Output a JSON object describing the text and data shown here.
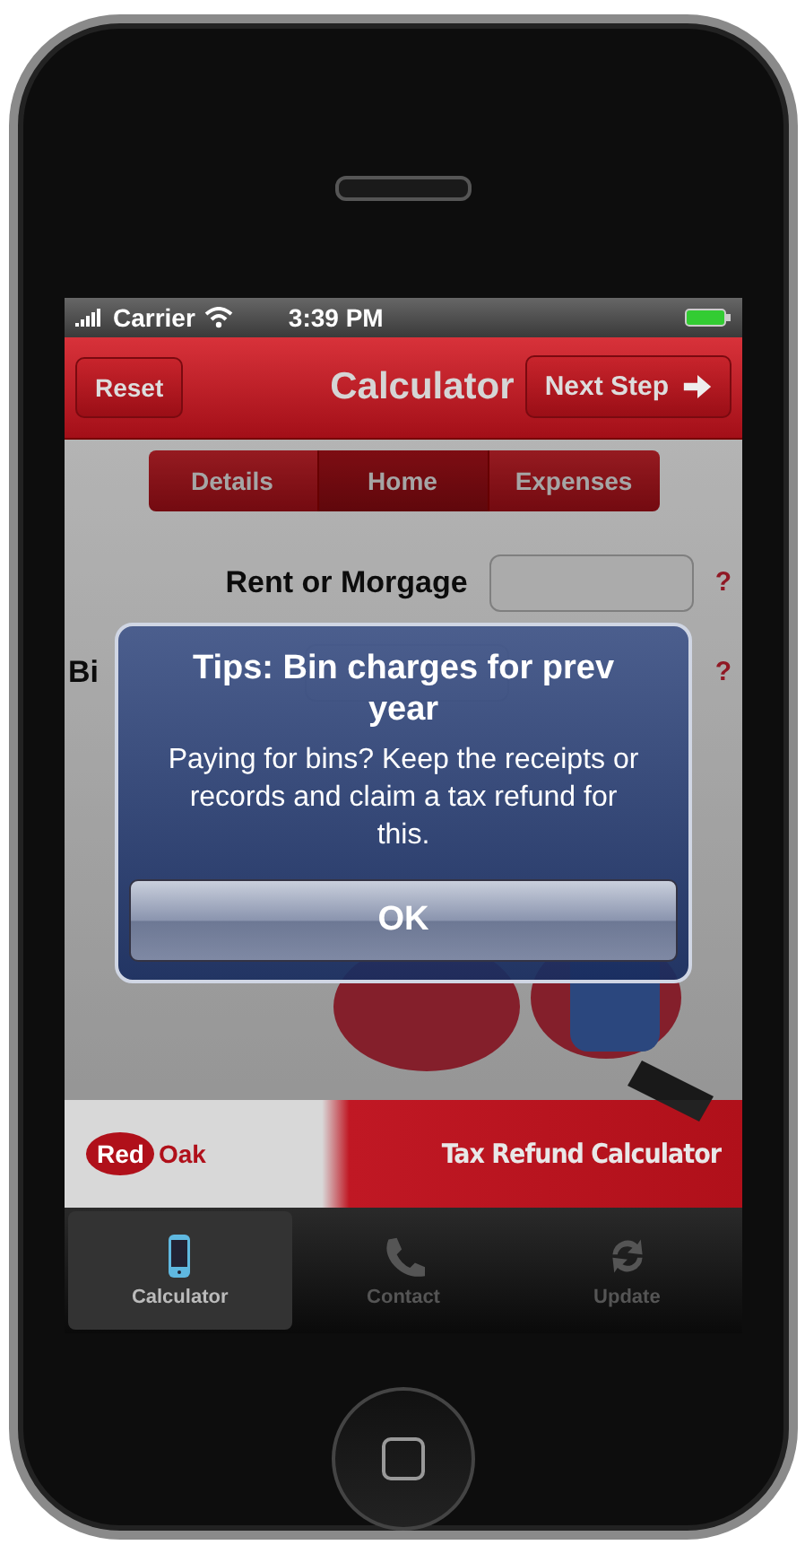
{
  "status_bar": {
    "carrier": "Carrier",
    "time": "3:39 PM"
  },
  "nav_bar": {
    "left_button": "Reset",
    "title": "Calculator",
    "right_button": "Next Step"
  },
  "segments": [
    {
      "label": "Details",
      "selected": false
    },
    {
      "label": "Home",
      "selected": true
    },
    {
      "label": "Expenses",
      "selected": false
    }
  ],
  "form_rows": [
    {
      "label": "Rent or Morgage",
      "help": "?"
    },
    {
      "label": "Bi",
      "help": "?"
    }
  ],
  "alert": {
    "title": "Tips: Bin charges for prev year",
    "message": "Paying for bins? Keep the receipts or records and claim a tax refund for this.",
    "button": "OK"
  },
  "banner": {
    "logo_left": "Red",
    "logo_right": "Oak",
    "title": "Tax Refund Calculator"
  },
  "tab_bar": [
    {
      "label": "Calculator",
      "kind": "phone",
      "selected": true
    },
    {
      "label": "Contact",
      "kind": "handset",
      "selected": false
    },
    {
      "label": "Update",
      "kind": "refresh",
      "selected": false
    }
  ]
}
